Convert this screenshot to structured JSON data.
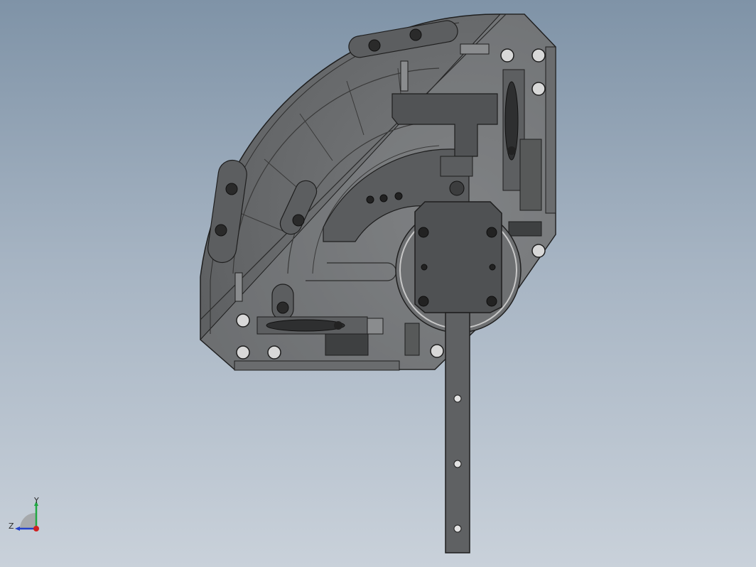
{
  "view": {
    "type": "cad-3d-viewport",
    "background_top": "#7f93a7",
    "background_bottom": "#c9d1da"
  },
  "model": {
    "part_color": "#6f7173",
    "part_dark": "#4a4b4c",
    "edge_color": "#1e1e1e",
    "hole_count_strip": 3
  },
  "triad": {
    "y_label": "Y",
    "z_label": "Z",
    "y_color": "#22a844",
    "z_color": "#2442c9",
    "x_color": "#d02020"
  }
}
